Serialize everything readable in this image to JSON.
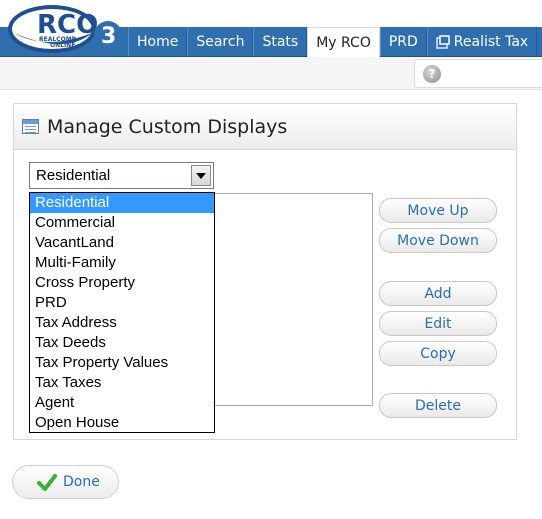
{
  "header": {
    "logo_text": "RCO",
    "logo_sub1": "REALCOMP",
    "logo_sub2": "ONLINE",
    "logo_number": "3",
    "tabs": [
      {
        "label": "Home",
        "active": false
      },
      {
        "label": "Search",
        "active": false
      },
      {
        "label": "Stats",
        "active": false
      },
      {
        "label": "My RCO",
        "active": true
      },
      {
        "label": "PRD",
        "active": false
      },
      {
        "label": "Realist Tax",
        "active": false,
        "icon": "external-window-icon"
      }
    ]
  },
  "subbar": {
    "help_icon": "help-icon",
    "help_glyph": "?"
  },
  "panel": {
    "title": "Manage Custom Displays",
    "icon": "table-icon"
  },
  "display_select": {
    "value": "Residential",
    "options": [
      "Residential",
      "Commercial",
      "VacantLand",
      "Multi-Family",
      "Cross Property",
      "PRD",
      "Tax Address",
      "Tax Deeds",
      "Tax Property Values",
      "Tax Taxes",
      "Agent",
      "Open House"
    ],
    "highlighted_index": 0
  },
  "buttons": {
    "move_up": "Move Up",
    "move_down": "Move Down",
    "add": "Add",
    "edit": "Edit",
    "copy": "Copy",
    "delete": "Delete",
    "done": "Done"
  },
  "colors": {
    "nav_blue": "#2f6fb0",
    "link_blue": "#2a6cb5",
    "selection_blue": "#3399ff",
    "done_check_green": "#3cae3c"
  }
}
